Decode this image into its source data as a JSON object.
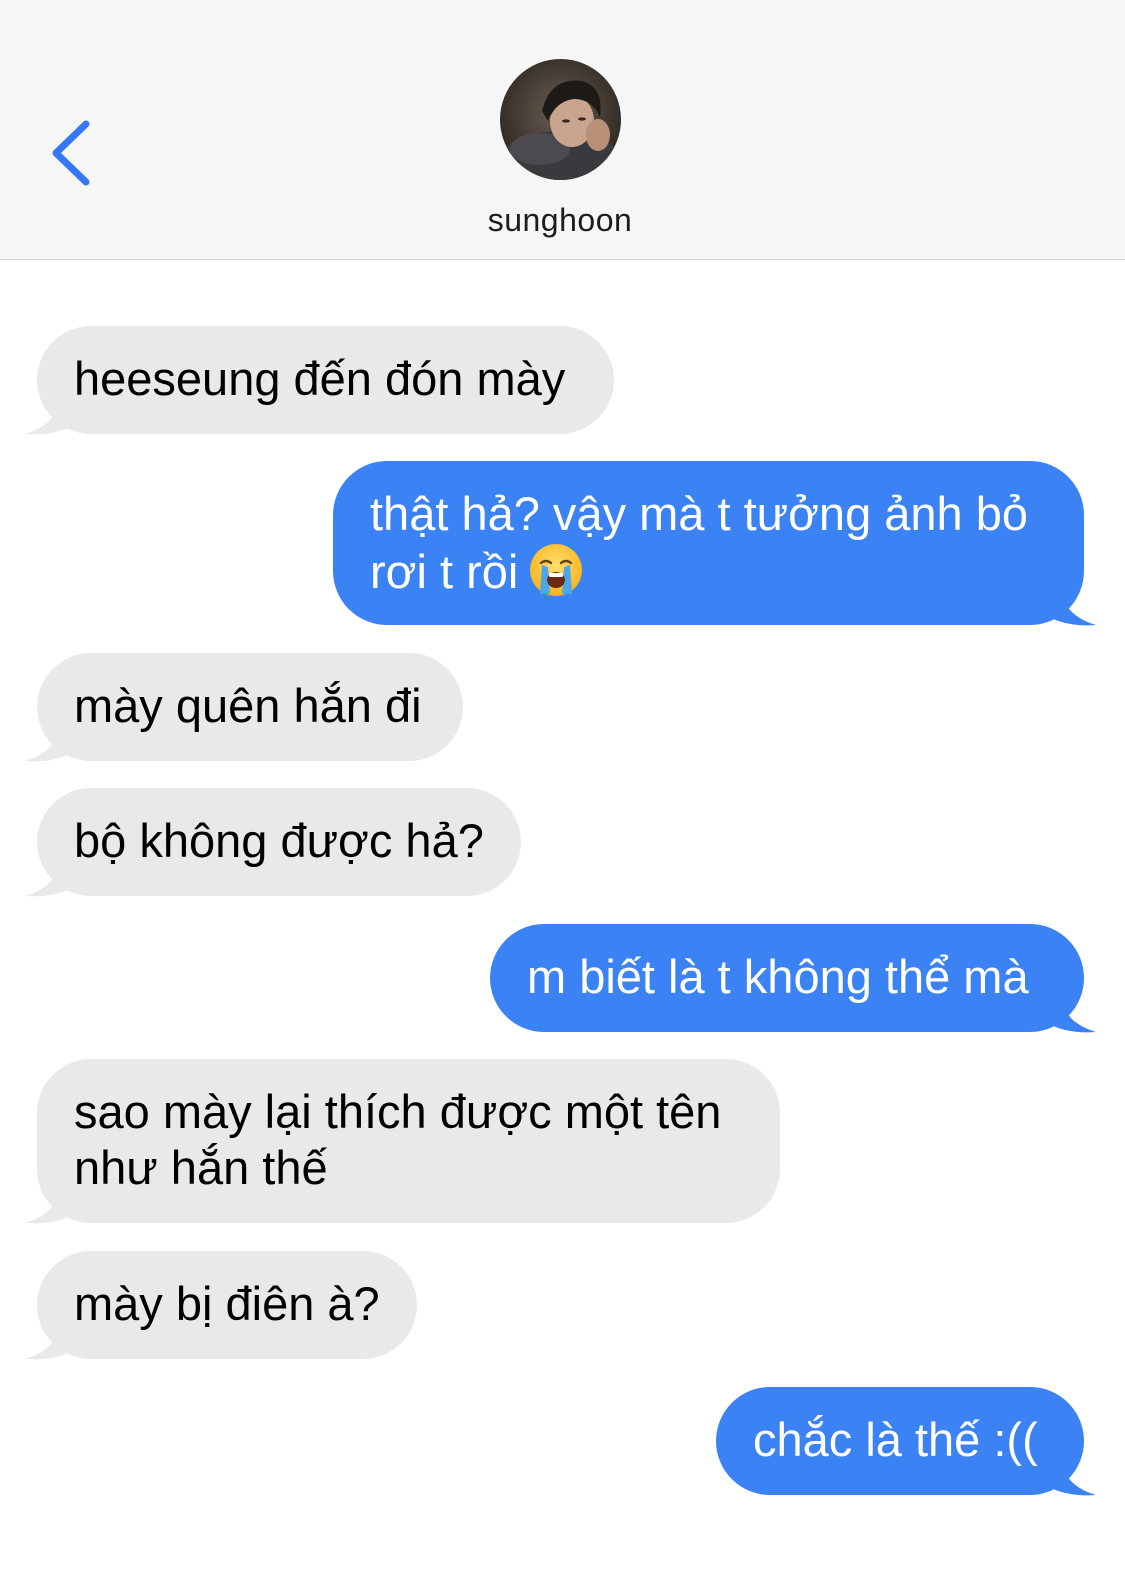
{
  "header": {
    "contact_name": "sunghoon",
    "back_icon": "chevron-left-icon",
    "avatar": "contact-avatar"
  },
  "colors": {
    "incoming_bubble": "#e9e9eb",
    "outgoing_bubble": "#3b82f5",
    "accent": "#3478f6",
    "header_bg": "#f6f6f6"
  },
  "messages": [
    {
      "direction": "incoming",
      "text": "heeseung đến đón mày"
    },
    {
      "direction": "outgoing",
      "line1": "thật hả? vậy mà t tưởng ảnh bỏ",
      "line2": "rơi t rồi",
      "emoji": "loudly-crying-face-icon"
    },
    {
      "direction": "incoming",
      "text": "mày quên hắn đi"
    },
    {
      "direction": "incoming",
      "text": "bộ không được hả?"
    },
    {
      "direction": "outgoing",
      "text": "m biết là t không thể mà"
    },
    {
      "direction": "incoming",
      "line1": "sao mày lại thích được một tên",
      "line2": "như hắn thế"
    },
    {
      "direction": "incoming",
      "text": "mày bị điên à?"
    },
    {
      "direction": "outgoing",
      "text": "chắc là thế :(("
    }
  ]
}
